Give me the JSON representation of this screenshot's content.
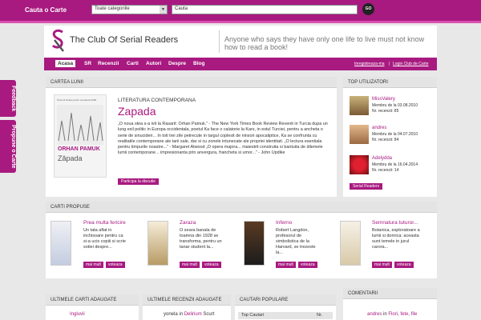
{
  "topbar": {
    "label": "Cauta o Carte",
    "category": "Toate categoriile",
    "search_value": "Cauta",
    "go": "GO"
  },
  "header": {
    "title": "The Club Of Serial Readers",
    "tagline": "Anyone who says they have only one life to live must not know how to read a book!"
  },
  "nav": {
    "items": [
      "Acasa",
      "SR",
      "Recenzii",
      "Carti",
      "Autori",
      "Despre",
      "Blog"
    ],
    "link1": "Inregistreaza-ma",
    "sep": "|",
    "link2": "Login Club de Carte"
  },
  "side_tabs": {
    "feedback": "Feedback",
    "propune": "Propune o Carte"
  },
  "book_of_month": {
    "header": "CARTEA LUNII",
    "genre": "LITERATURA CONTEMPORANA",
    "title": "Zapada",
    "cover_author": "ORHAN PAMUK",
    "cover_title": "Zăpada",
    "cover_top": "Premiul Nobel pentru Literatură 2006",
    "description": "„O noua stea s-a ivit la Rasarit: Orhan Pamuk.” - The New York Times Book Review Revenit in Turcia dupa un lung exil politic in Europa occidentala, poetul Ka face o calatorie la Kars, in estul Turciei, pentru a ancheta o serie de sinucideri... In toti trei zile petrecute in targul coplesit de ninsori apocaliptice, Ka se confrunta cu realitatile contemporane ale tarii sale, dar si cu zonele intunecate ale propriei identitati. „O lectura esentiala pentru timpurile noastre...” - Margaret Atwood „O opera majora... maiestrit construita si bantuita de dilemele lumii contemporane... impresionanta prin anvergura, francheta si umor...” - John Updike",
    "button": "Participa la discutie"
  },
  "top_users": {
    "header": "TOP UTILIZATORI",
    "users": [
      {
        "name": "MissValery",
        "member": "Membru de la 03.08.2010",
        "reviews": "Nr. recenzii: 85"
      },
      {
        "name": "andres",
        "member": "Membru de la 04.07.2010",
        "reviews": "Nr. recenzii: 84"
      },
      {
        "name": "Adelydda",
        "member": "Membru de la 16.04.2014",
        "reviews": "Nr. recenzii: 14"
      }
    ],
    "button": "Serial Readers"
  },
  "proposed": {
    "header": "CARTI PROPUSE",
    "books": [
      {
        "title": "Prea multa fericire",
        "desc": "Un tata aflat in inchisoare pentru ca si-a ucis copiii si scrie sotiei despre...",
        "more": "mai mult",
        "vote": "voteaza"
      },
      {
        "title": "Zaraza",
        "desc": "O seara banala de toamna din 1928 se transforma, pentru un tanar student la...",
        "more": "mai mult",
        "vote": "voteaza"
      },
      {
        "title": "Inferno",
        "desc": "Robert Langdon, profesorul de simbolistica de la Harvard, se trezeste la...",
        "more": "mai mult",
        "vote": "voteaza"
      },
      {
        "title": "Semnatura tuturor...",
        "desc": "Botanica, exploratoare a lumii si dornica: aceasta sunt temele in jurul carora...",
        "more": "mai mult",
        "vote": "voteaza"
      }
    ]
  },
  "bottom": {
    "latest_books": "ULTIMELE CARTI ADAUGATE",
    "latest_book_item": "Ingluvii",
    "latest_reviews": "ULTIMELE RECENZII ADAUGATE",
    "review_user": "yonela",
    "review_in": "in",
    "review_book": "Delirium",
    "review_more": "Scurt",
    "popular": "CAUTARI POPULARE",
    "top_searches": "Top Cautari",
    "searches_col": "Nr.",
    "comments": "COMENTARII",
    "comment_user": "andres",
    "comment_in": "in",
    "comment_book": "Flori, fete, file"
  },
  "colors": {
    "brand": "#a81a80",
    "accent": "#d94fb0"
  }
}
